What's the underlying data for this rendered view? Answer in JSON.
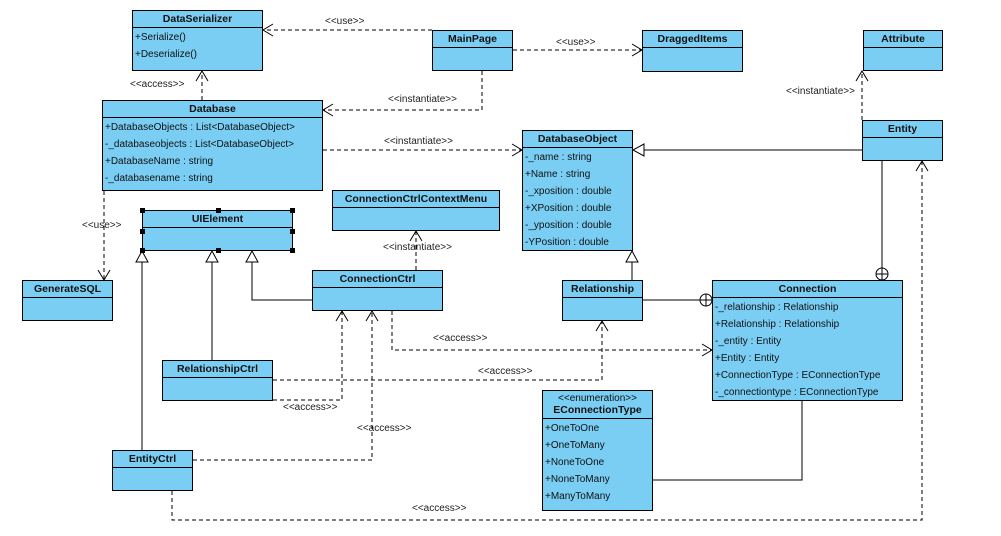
{
  "classes": [
    {
      "name": "DataSerializer",
      "members": [
        "+Serialize()",
        "+Deserialize()"
      ]
    },
    {
      "name": "MainPage",
      "members": []
    },
    {
      "name": "DraggedItems",
      "members": []
    },
    {
      "name": "Attribute",
      "members": []
    },
    {
      "name": "Database",
      "members": [
        "+DatabaseObjects : List<DatabaseObject>",
        "-_databaseobjects : List<DatabaseObject>",
        "+DatabaseName : string",
        "-_databasename : string"
      ]
    },
    {
      "name": "DatabaseObject",
      "members": [
        "-_name : string",
        "+Name : string",
        "-_xposition : double",
        "+XPosition : double",
        "-_yposition : double",
        "-YPosition : double"
      ]
    },
    {
      "name": "Entity",
      "members": []
    },
    {
      "name": "UIElement",
      "members": []
    },
    {
      "name": "ConnectionCtrlContextMenu",
      "members": []
    },
    {
      "name": "GenerateSQL",
      "members": []
    },
    {
      "name": "ConnectionCtrl",
      "members": []
    },
    {
      "name": "Relationship",
      "members": []
    },
    {
      "name": "Connection",
      "members": [
        "-_relationship : Relationship",
        "+Relationship : Relationship",
        "-_entity : Entity",
        "+Entity : Entity",
        "+ConnectionType : EConnectionType",
        "-_connectiontype : EConnectionType"
      ]
    },
    {
      "name": "RelationshipCtrl",
      "members": []
    },
    {
      "name": "EConnectionType",
      "stereotype": "<<enumeration>>",
      "members": [
        "+OneToOne",
        "+OneToMany",
        "+NoneToOne",
        "+NoneToMany",
        "+ManyToMany"
      ]
    },
    {
      "name": "EntityCtrl",
      "members": []
    }
  ],
  "relations": [
    {
      "from": "MainPage",
      "to": "DataSerializer",
      "kind": "dependency",
      "label": "<<use>>"
    },
    {
      "from": "MainPage",
      "to": "DraggedItems",
      "kind": "dependency",
      "label": "<<use>>"
    },
    {
      "from": "MainPage",
      "to": "Database",
      "kind": "dependency",
      "label": "<<instantiate>>"
    },
    {
      "from": "Database",
      "to": "DataSerializer",
      "kind": "dependency",
      "label": "<<access>>"
    },
    {
      "from": "Database",
      "to": "DatabaseObject",
      "kind": "dependency",
      "label": "<<instantiate>>"
    },
    {
      "from": "Entity",
      "to": "Attribute",
      "kind": "dependency",
      "label": "<<instantiate>>"
    },
    {
      "from": "Database",
      "to": "GenerateSQL",
      "kind": "dependency",
      "label": "<<use>>"
    },
    {
      "from": "ConnectionCtrl",
      "to": "ConnectionCtrlContextMenu",
      "kind": "dependency",
      "label": "<<instantiate>>"
    },
    {
      "from": "ConnectionCtrl",
      "to": "Connection",
      "kind": "dependency",
      "label": "<<access>>"
    },
    {
      "from": "RelationshipCtrl",
      "to": "Relationship",
      "kind": "dependency",
      "label": "<<access>>"
    },
    {
      "from": "RelationshipCtrl",
      "to": "ConnectionCtrl",
      "kind": "dependency",
      "label": "<<access>>"
    },
    {
      "from": "EntityCtrl",
      "to": "ConnectionCtrl",
      "kind": "dependency",
      "label": "<<access>>"
    },
    {
      "from": "EntityCtrl",
      "to": "Entity",
      "kind": "dependency",
      "label": "<<access>>"
    },
    {
      "from": "Entity",
      "to": "DatabaseObject",
      "kind": "generalization",
      "label": ""
    },
    {
      "from": "Relationship",
      "to": "DatabaseObject",
      "kind": "generalization",
      "label": ""
    },
    {
      "from": "RelationshipCtrl",
      "to": "UIElement",
      "kind": "generalization",
      "label": ""
    },
    {
      "from": "EntityCtrl",
      "to": "UIElement",
      "kind": "generalization",
      "label": ""
    },
    {
      "from": "ConnectionCtrl",
      "to": "UIElement",
      "kind": "generalization",
      "label": ""
    },
    {
      "from": "Entity",
      "to": "Connection",
      "kind": "containment",
      "label": ""
    },
    {
      "from": "Relationship",
      "to": "Connection",
      "kind": "containment",
      "label": ""
    },
    {
      "from": "Connection",
      "to": "EConnectionType",
      "kind": "association",
      "label": ""
    }
  ],
  "colors": {
    "class_fill": "#7acef4",
    "line": "#000000"
  },
  "selected": "UIElement"
}
